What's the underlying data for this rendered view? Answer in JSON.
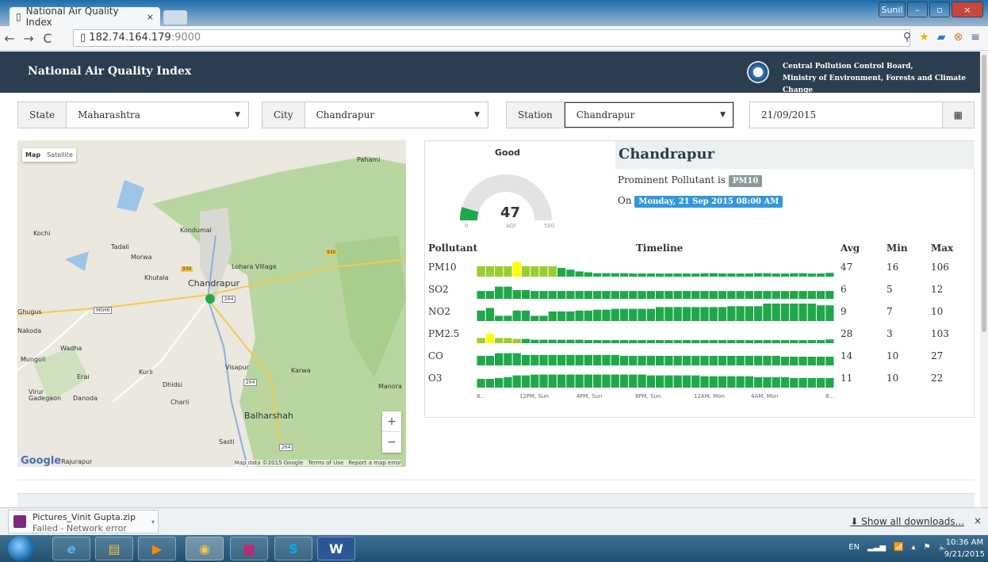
{
  "browser": {
    "tab_title": "National Air Quality Index",
    "url_host": "182.74.164.179",
    "url_port": ":9000",
    "user": "Sunil"
  },
  "header": {
    "title": "National Air Quality Index",
    "org_line1": "Central Pollution Control Board,",
    "org_line2": "Ministry of Environment, Forests and Climate Change"
  },
  "filters": {
    "state_label": "State",
    "state_value": "Maharashtra",
    "city_label": "City",
    "city_value": "Chandrapur",
    "station_label": "Station",
    "station_value": "Chandrapur",
    "date_value": "21/09/2015"
  },
  "map": {
    "tab_map": "Map",
    "tab_satellite": "Satellite",
    "attribution": "Map data ©2015 Google",
    "terms": "Terms of Use",
    "report": "Report a map error",
    "logo": "Google",
    "places": [
      "Pahami",
      "Kochi",
      "Kondumal",
      "Tadali",
      "Morwa",
      "Lohara Village",
      "Khutala",
      "Chandrapur",
      "Ghugus",
      "Nakoda",
      "Wadha",
      "Mungoli",
      "Erai",
      "Kurli",
      "Visapur",
      "Karwa",
      "Dhidsi",
      "Virur",
      "Gadegaon",
      "Danoda",
      "Charli",
      "Manora",
      "Balharshah",
      "Sasti",
      "Rajurapur"
    ],
    "road_labels": [
      "930",
      "930",
      "264",
      "MSH6",
      "264",
      "264"
    ]
  },
  "aqi": {
    "status": "Good",
    "value": "47",
    "label": "AQI",
    "min": "0",
    "max": "500",
    "value_fraction": 0.094,
    "status_color": "#1fa84a"
  },
  "station": {
    "name": "Chandrapur",
    "prominent_prefix": "Prominent Pollutant is",
    "prominent": "PM10",
    "on_prefix": "On",
    "timestamp": "Monday, 21 Sep 2015 08:00 AM"
  },
  "table": {
    "headers": {
      "pollutant": "Pollutant",
      "timeline": "Timeline",
      "avg": "Avg",
      "min": "Min",
      "max": "Max"
    },
    "rows": [
      {
        "name": "PM10",
        "avg": "47",
        "min": "16",
        "max": "106",
        "series": [
          60,
          60,
          60,
          60,
          85,
          60,
          60,
          60,
          60,
          50,
          40,
          30,
          25,
          20,
          20,
          20,
          20,
          18,
          18,
          18,
          18,
          18,
          18,
          18,
          18,
          20,
          20,
          18,
          18,
          18,
          18,
          20,
          20,
          18,
          18,
          20,
          20,
          18,
          18,
          22
        ],
        "colors": [
          "g",
          "g",
          "g",
          "g",
          "y",
          "g",
          "g",
          "g",
          "g",
          "G",
          "G",
          "G",
          "G",
          "G",
          "G",
          "G",
          "G",
          "G",
          "G",
          "G",
          "G",
          "G",
          "G",
          "G",
          "G",
          "G",
          "G",
          "G",
          "G",
          "G",
          "G",
          "G",
          "G",
          "G",
          "G",
          "G",
          "G",
          "G",
          "G",
          "G"
        ]
      },
      {
        "name": "SO2",
        "avg": "6",
        "min": "5",
        "max": "12",
        "series": [
          45,
          45,
          70,
          70,
          50,
          50,
          45,
          45,
          45,
          45,
          45,
          45,
          45,
          45,
          45,
          45,
          45,
          45,
          45,
          45,
          45,
          45,
          45,
          45,
          45,
          45,
          45,
          45,
          45,
          45,
          45,
          45,
          45,
          45,
          45,
          45,
          45,
          45,
          45,
          45
        ],
        "colors": []
      },
      {
        "name": "NO2",
        "avg": "9",
        "min": "7",
        "max": "10",
        "series": [
          60,
          75,
          30,
          30,
          60,
          60,
          30,
          30,
          55,
          55,
          55,
          60,
          60,
          65,
          65,
          70,
          70,
          70,
          70,
          70,
          80,
          80,
          80,
          80,
          80,
          80,
          80,
          80,
          85,
          85,
          85,
          85,
          100,
          100,
          100,
          100,
          100,
          100,
          90,
          90
        ],
        "colors": []
      },
      {
        "name": "PM2.5",
        "avg": "28",
        "min": "3",
        "max": "103",
        "series": [
          30,
          55,
          30,
          30,
          25,
          25,
          20,
          20,
          20,
          20,
          20,
          20,
          18,
          18,
          18,
          18,
          18,
          18,
          18,
          18,
          18,
          18,
          18,
          18,
          18,
          18,
          18,
          18,
          18,
          18,
          18,
          18,
          18,
          18,
          18,
          18,
          18,
          18,
          18,
          22
        ],
        "colors": [
          "g",
          "y",
          "g",
          "g",
          "g",
          "G",
          "G",
          "G",
          "G",
          "G",
          "G",
          "G",
          "G",
          "G",
          "G",
          "G",
          "G",
          "G",
          "G",
          "G",
          "G",
          "G",
          "G",
          "G",
          "G",
          "G",
          "G",
          "G",
          "G",
          "G",
          "G",
          "G",
          "G",
          "G",
          "G",
          "G",
          "G",
          "G",
          "G",
          "G"
        ]
      },
      {
        "name": "CO",
        "avg": "14",
        "min": "10",
        "max": "27",
        "series": [
          55,
          55,
          70,
          70,
          70,
          60,
          60,
          60,
          60,
          60,
          60,
          60,
          60,
          60,
          60,
          60,
          55,
          55,
          55,
          55,
          55,
          55,
          55,
          55,
          55,
          55,
          55,
          55,
          55,
          55,
          55,
          55,
          55,
          55,
          50,
          50,
          50,
          50,
          50,
          50
        ],
        "colors": []
      },
      {
        "name": "O3",
        "avg": "11",
        "min": "10",
        "max": "22",
        "series": [
          50,
          50,
          55,
          60,
          70,
          70,
          75,
          75,
          75,
          75,
          75,
          75,
          75,
          75,
          75,
          75,
          75,
          75,
          75,
          70,
          70,
          70,
          70,
          70,
          70,
          65,
          65,
          65,
          65,
          65,
          65,
          60,
          60,
          60,
          60,
          55,
          55,
          55,
          55,
          55
        ],
        "colors": []
      }
    ],
    "x_ticks": [
      "8...",
      "12PM, Sun",
      "4PM, Sun",
      "8PM, Sun",
      "12AM, Mon",
      "4AM, Mon",
      "8..."
    ]
  },
  "downloads": {
    "file": "Pictures_Vinit Gupta.zip",
    "status": "Failed - Network error",
    "show_all": "Show all downloads..."
  },
  "taskbar": {
    "lang": "EN",
    "time": "10:36 AM",
    "date": "9/21/2015",
    "apps": [
      "IE",
      "Explorer",
      "Media",
      "Chrome",
      "Apps",
      "Skype",
      "Word"
    ]
  },
  "colors": {
    "good": "#1fa84a",
    "satisfactory": "#9acd32",
    "moderate": "#ffff00",
    "header": "#2b3e50",
    "badge_pollutant": "#7f8c8d",
    "badge_time": "#3498db"
  }
}
